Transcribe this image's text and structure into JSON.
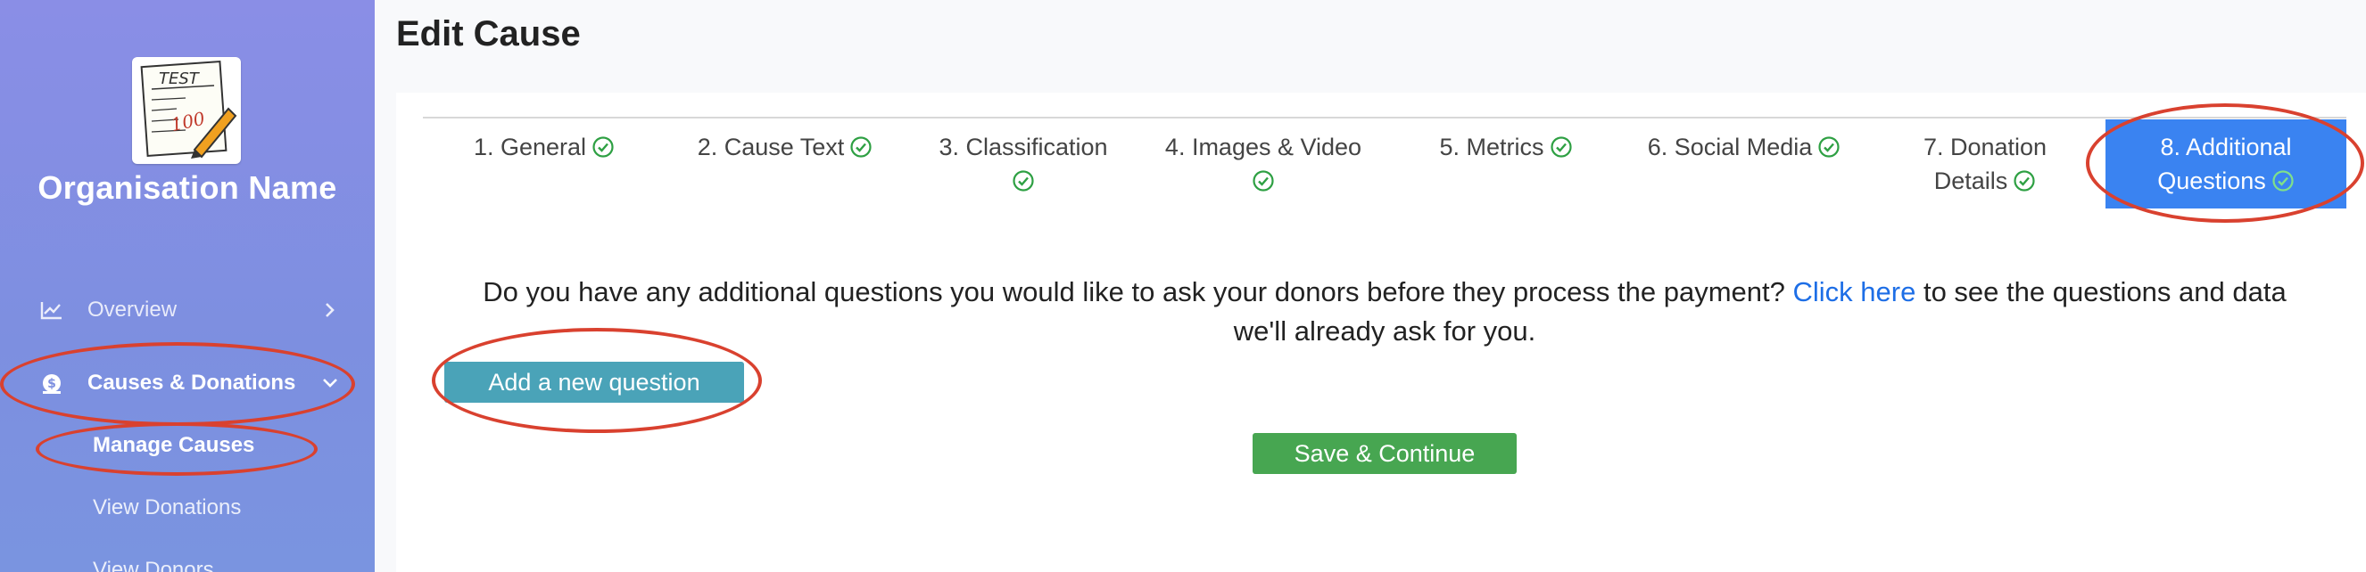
{
  "sidebar": {
    "org_name": "Organisation Name",
    "logo_text": "TEST",
    "logo_score": "100",
    "nav": [
      {
        "label": "Overview",
        "icon": "chart-line-icon",
        "chevron": "chevron-right-icon"
      },
      {
        "label": "Causes & Donations",
        "icon": "money-bag-icon",
        "chevron": "chevron-down-icon"
      }
    ],
    "sub_items": [
      "Manage Causes",
      "View Donations",
      "View Donors"
    ]
  },
  "page": {
    "title": "Edit Cause"
  },
  "tabs": [
    {
      "line1": "1. General",
      "line2": "",
      "complete": true
    },
    {
      "line1": "2. Cause Text",
      "line2": "",
      "complete": true
    },
    {
      "line1": "3. Classification",
      "line2": "",
      "complete": true
    },
    {
      "line1": "4. Images & Video",
      "line2": "",
      "complete": true
    },
    {
      "line1": "5. Metrics",
      "line2": "",
      "complete": true
    },
    {
      "line1": "6. Social Media",
      "line2": "",
      "complete": true
    },
    {
      "line1": "7. Donation",
      "line2": "Details",
      "complete": true
    },
    {
      "line1": "8. Additional",
      "line2": "Questions",
      "complete": true,
      "active": true
    }
  ],
  "content": {
    "question_before": "Do you have any additional questions you would like to ask your donors before they process the payment?",
    "link_text": "Click here",
    "question_after": "to see the questions and data",
    "question_line2": "we'll already ask for you.",
    "add_button": "Add a new question",
    "save_button": "Save & Continue"
  },
  "colors": {
    "sidebar": "#8a8ee6",
    "active_tab": "#3a83f1",
    "add_button": "#4aa3b8",
    "save_button": "#47a651",
    "link": "#1d6ee6",
    "annotation": "#d9412f",
    "check": "#2ea043"
  }
}
